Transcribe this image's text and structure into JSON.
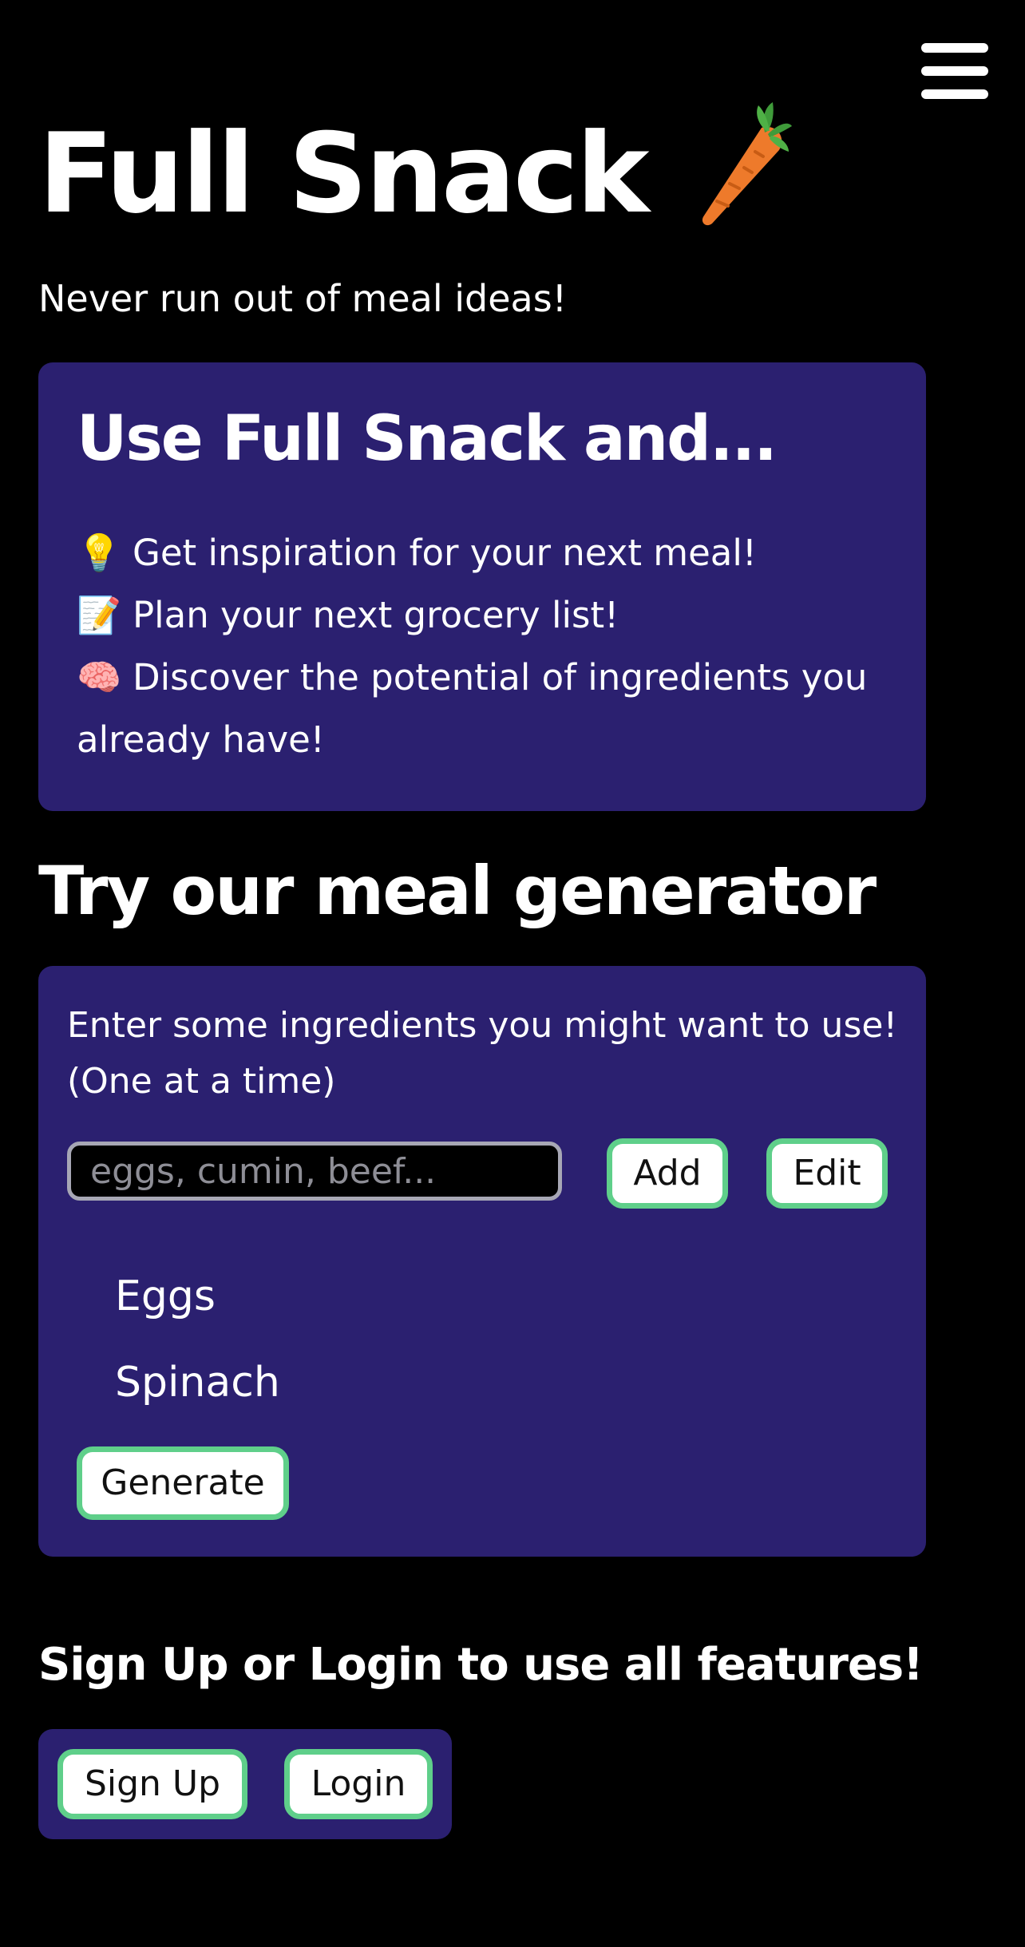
{
  "header": {
    "title": "Full Snack",
    "title_icon": "carrot-icon",
    "tagline": "Never run out of meal ideas!",
    "menu_icon": "hamburger-menu-icon"
  },
  "features": {
    "heading": "Use Full Snack and...",
    "items": [
      {
        "emoji": "💡",
        "icon": "lightbulb-icon",
        "text": "Get inspiration for your next meal!"
      },
      {
        "emoji": "📝",
        "icon": "memo-icon",
        "text": "Plan your next grocery list!"
      },
      {
        "emoji": "🧠",
        "icon": "brain-icon",
        "text": "Discover the potential of ingredients you already have!"
      }
    ]
  },
  "generator": {
    "section_title": "Try our meal generator",
    "instructions": "Enter some ingredients you might want to use! (One at a time)",
    "input_placeholder": "eggs, cumin, beef...",
    "input_value": "",
    "add_label": "Add",
    "edit_label": "Edit",
    "ingredients": [
      "Eggs",
      "Spinach"
    ],
    "generate_label": "Generate"
  },
  "auth": {
    "cta": "Sign Up or Login to use all features!",
    "signup_label": "Sign Up",
    "login_label": "Login"
  },
  "colors": {
    "background": "#000000",
    "panel": "#2b2070",
    "button_border": "#5fcf8a",
    "text": "#ffffff"
  }
}
